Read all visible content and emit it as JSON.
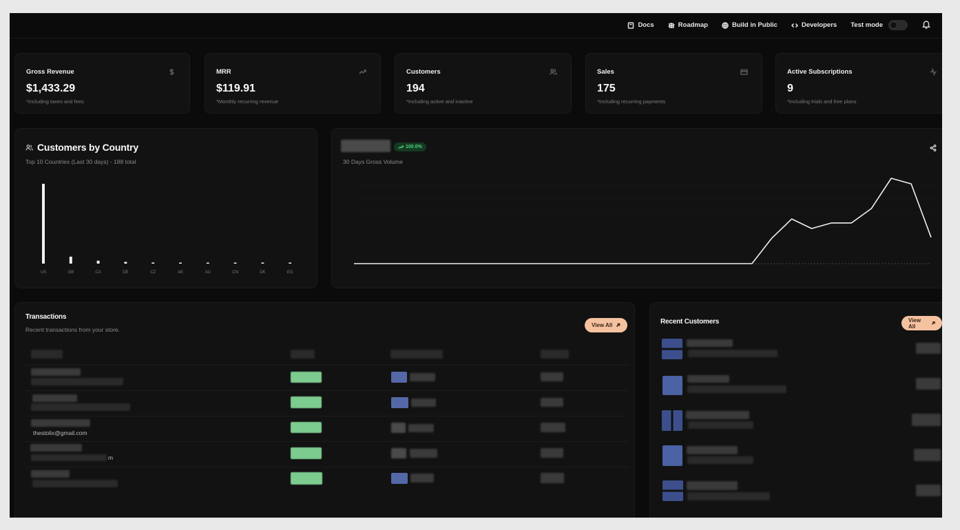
{
  "nav": {
    "docs": "Docs",
    "roadmap": "Roadmap",
    "build": "Build in Public",
    "developers": "Developers",
    "test_mode": "Test mode"
  },
  "stats": [
    {
      "label": "Gross Revenue",
      "value": "$1,433.29",
      "note": "*Including taxes and fees",
      "icon": "dollar-icon"
    },
    {
      "label": "MRR",
      "value": "$119.91",
      "note": "*Monthly recurring revenue",
      "icon": "trending-up-icon"
    },
    {
      "label": "Customers",
      "value": "194",
      "note": "*Including active and inactive",
      "icon": "users-icon"
    },
    {
      "label": "Sales",
      "value": "175",
      "note": "*Including recurring payments",
      "icon": "credit-card-icon"
    },
    {
      "label": "Active Subscriptions",
      "value": "9",
      "note": "*Including trials and free plans",
      "icon": "activity-icon"
    }
  ],
  "country_panel": {
    "title": "Customers by Country",
    "subtitle": "Top 10 Countries (Last 30 days) - 188 total"
  },
  "volume_panel": {
    "badge": "100.0%",
    "subtitle": "30 Days Gross Volume"
  },
  "transactions": {
    "title": "Transactions",
    "subtitle": "Recent transactions from your store.",
    "view_all": "View All",
    "visible_email": "thestolix@gmail.com",
    "visible_char": "m"
  },
  "recent_customers": {
    "title": "Recent Customers",
    "view_all": "View All"
  },
  "chart_data": [
    {
      "type": "bar",
      "categories": [
        "US",
        "GB",
        "CA",
        "DE",
        "CZ",
        "AE",
        "AU",
        "CN",
        "DK",
        "EG"
      ],
      "values": [
        138,
        12,
        5,
        3,
        2,
        1,
        1,
        1,
        1,
        1
      ],
      "title": "Customers by Country"
    },
    {
      "type": "line",
      "x": [
        1,
        2,
        3,
        4,
        5,
        6,
        7,
        8,
        9,
        10,
        11,
        12,
        13,
        14,
        15,
        16,
        17,
        18,
        19,
        20,
        21,
        22,
        23,
        24,
        25,
        26,
        27,
        28,
        29,
        30
      ],
      "series": [
        {
          "values": [
            0,
            0,
            0,
            0,
            0,
            0,
            0,
            0,
            0,
            0,
            0,
            0,
            0,
            0,
            0,
            0,
            0,
            0,
            0,
            0,
            0,
            32,
            56,
            44,
            51,
            51,
            69,
            107,
            100,
            33
          ]
        }
      ]
    }
  ]
}
